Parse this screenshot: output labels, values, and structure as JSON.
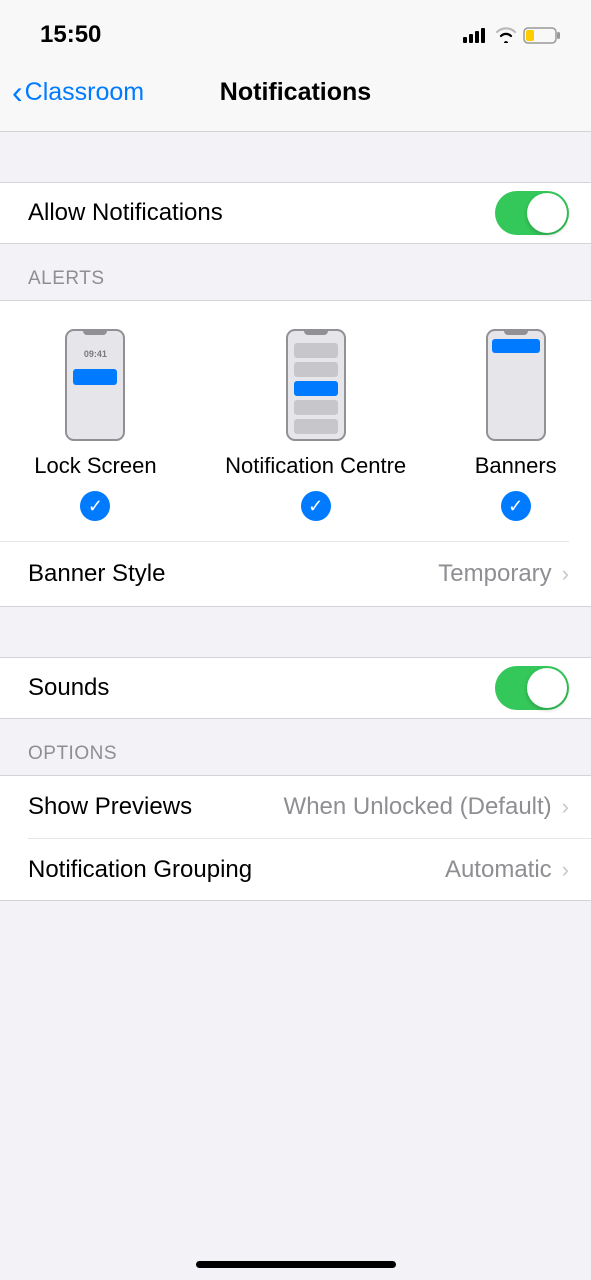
{
  "status": {
    "time": "15:50"
  },
  "nav": {
    "back": "Classroom",
    "title": "Notifications"
  },
  "allow": {
    "label": "Allow Notifications",
    "on": true
  },
  "alerts": {
    "header": "ALERTS",
    "lockTime": "09:41",
    "items": [
      {
        "label": "Lock Screen",
        "checked": true
      },
      {
        "label": "Notification Centre",
        "checked": true
      },
      {
        "label": "Banners",
        "checked": true
      }
    ]
  },
  "bannerStyle": {
    "label": "Banner Style",
    "value": "Temporary"
  },
  "sounds": {
    "label": "Sounds",
    "on": true
  },
  "options": {
    "header": "OPTIONS",
    "showPreviews": {
      "label": "Show Previews",
      "value": "When Unlocked (Default)"
    },
    "grouping": {
      "label": "Notification Grouping",
      "value": "Automatic"
    }
  }
}
